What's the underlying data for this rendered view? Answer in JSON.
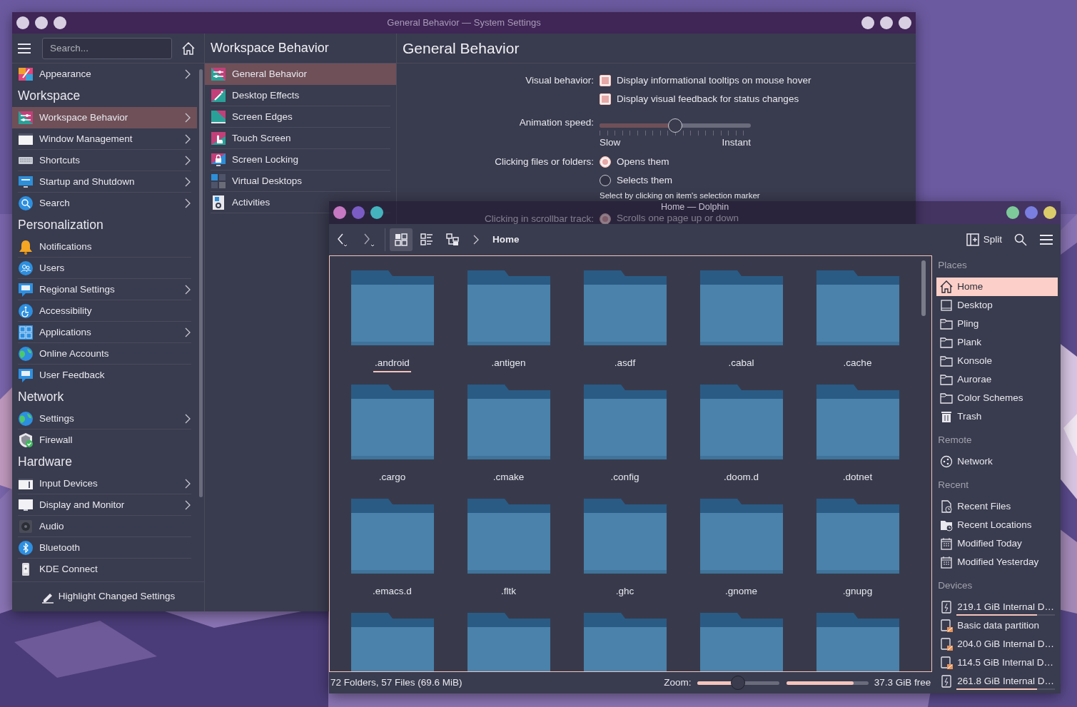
{
  "settings_window": {
    "title": "General Behavior — System Settings",
    "search": {
      "placeholder": "Search..."
    },
    "sidebar": [
      {
        "kind": "item",
        "label": "Appearance",
        "chevron": true,
        "selected": false
      },
      {
        "kind": "heading",
        "label": "Workspace"
      },
      {
        "kind": "item",
        "label": "Workspace Behavior",
        "chevron": true,
        "selected": true
      },
      {
        "kind": "item",
        "label": "Window Management",
        "chevron": true,
        "selected": false
      },
      {
        "kind": "item",
        "label": "Shortcuts",
        "chevron": true,
        "selected": false
      },
      {
        "kind": "item",
        "label": "Startup and Shutdown",
        "chevron": true,
        "selected": false
      },
      {
        "kind": "item",
        "label": "Search",
        "chevron": true,
        "selected": false
      },
      {
        "kind": "heading",
        "label": "Personalization"
      },
      {
        "kind": "item",
        "label": "Notifications",
        "chevron": false,
        "selected": false
      },
      {
        "kind": "item",
        "label": "Users",
        "chevron": false,
        "selected": false
      },
      {
        "kind": "item",
        "label": "Regional Settings",
        "chevron": true,
        "selected": false
      },
      {
        "kind": "item",
        "label": "Accessibility",
        "chevron": false,
        "selected": false
      },
      {
        "kind": "item",
        "label": "Applications",
        "chevron": true,
        "selected": false
      },
      {
        "kind": "item",
        "label": "Online Accounts",
        "chevron": false,
        "selected": false
      },
      {
        "kind": "item",
        "label": "User Feedback",
        "chevron": false,
        "selected": false
      },
      {
        "kind": "heading",
        "label": "Network"
      },
      {
        "kind": "item",
        "label": "Settings",
        "chevron": true,
        "selected": false
      },
      {
        "kind": "item",
        "label": "Firewall",
        "chevron": false,
        "selected": false
      },
      {
        "kind": "heading",
        "label": "Hardware"
      },
      {
        "kind": "item",
        "label": "Input Devices",
        "chevron": true,
        "selected": false
      },
      {
        "kind": "item",
        "label": "Display and Monitor",
        "chevron": true,
        "selected": false
      },
      {
        "kind": "item",
        "label": "Audio",
        "chevron": false,
        "selected": false
      },
      {
        "kind": "item",
        "label": "Bluetooth",
        "chevron": false,
        "selected": false
      },
      {
        "kind": "item",
        "label": "KDE Connect",
        "chevron": false,
        "selected": false
      }
    ],
    "footer_button": "Highlight Changed Settings",
    "subpage": {
      "title": "Workspace Behavior",
      "items": [
        {
          "label": "General Behavior",
          "selected": true
        },
        {
          "label": "Desktop Effects",
          "selected": false
        },
        {
          "label": "Screen Edges",
          "selected": false
        },
        {
          "label": "Touch Screen",
          "selected": false
        },
        {
          "label": "Screen Locking",
          "selected": false
        },
        {
          "label": "Virtual Desktops",
          "selected": false
        },
        {
          "label": "Activities",
          "selected": false
        }
      ]
    },
    "page": {
      "title": "General Behavior",
      "rows": [
        {
          "kind": "checkboxes",
          "label": "Visual behavior:",
          "options": [
            {
              "label": "Display informational tooltips on mouse hover",
              "checked": true
            },
            {
              "label": "Display visual feedback for status changes",
              "checked": true
            }
          ]
        },
        {
          "kind": "slider",
          "label": "Animation speed:",
          "level": 0.5,
          "min_label": "Slow",
          "max_label": "Instant"
        },
        {
          "kind": "radios",
          "label": "Clicking files or folders:",
          "options": [
            {
              "label": "Opens them",
              "selected": true
            },
            {
              "label": "Selects them",
              "selected": false
            }
          ],
          "hint": "Select by clicking on item's selection marker"
        },
        {
          "kind": "radios",
          "label": "Clicking in scrollbar track:",
          "options": [
            {
              "label": "Scrolls one page up or down",
              "selected": true
            }
          ]
        }
      ]
    }
  },
  "dolphin_window": {
    "title": "Home — Dolphin",
    "buttons_left": [
      {
        "color": "#c678c2"
      },
      {
        "color": "#7b5cc4"
      },
      {
        "color": "#45b3bd"
      }
    ],
    "buttons_right": [
      {
        "color": "#7ec99a"
      },
      {
        "color": "#7a7ee0"
      },
      {
        "color": "#dccb6a"
      }
    ],
    "toolbar": {
      "view_modes": [
        {
          "selected": true
        },
        {
          "selected": false
        },
        {
          "selected": false
        }
      ],
      "breadcrumb": "Home",
      "split_button": "Split"
    },
    "files": [
      {
        "name": ".android",
        "selected": true
      },
      {
        "name": ".antigen",
        "selected": false
      },
      {
        "name": ".asdf",
        "selected": false
      },
      {
        "name": ".cabal",
        "selected": false
      },
      {
        "name": ".cache",
        "selected": false
      },
      {
        "name": ".cargo",
        "selected": false
      },
      {
        "name": ".cmake",
        "selected": false
      },
      {
        "name": ".config",
        "selected": false
      },
      {
        "name": ".doom.d",
        "selected": false
      },
      {
        "name": ".dotnet",
        "selected": false
      },
      {
        "name": ".emacs.d",
        "selected": false
      },
      {
        "name": ".fltk",
        "selected": false
      },
      {
        "name": ".ghc",
        "selected": false
      },
      {
        "name": ".gnome",
        "selected": false
      },
      {
        "name": ".gnupg",
        "selected": false
      },
      {
        "selected": false
      },
      {
        "selected": false
      },
      {
        "selected": false
      },
      {
        "selected": false
      },
      {
        "selected": false
      }
    ],
    "places": [
      {
        "heading": "Places",
        "items": [
          {
            "kind": "home",
            "label": "Home",
            "selected": true
          },
          {
            "kind": "desktop",
            "label": "Desktop",
            "selected": false
          },
          {
            "kind": "folder",
            "label": "Pling",
            "selected": false
          },
          {
            "kind": "folder",
            "label": "Plank",
            "selected": false
          },
          {
            "kind": "folder",
            "label": "Konsole",
            "selected": false
          },
          {
            "kind": "folder",
            "label": "Aurorae",
            "selected": false
          },
          {
            "kind": "folder",
            "label": "Color Schemes",
            "selected": false
          },
          {
            "kind": "trash",
            "label": "Trash",
            "selected": false
          }
        ]
      },
      {
        "heading": "Remote",
        "items": [
          {
            "kind": "network",
            "label": "Network",
            "selected": false
          }
        ]
      },
      {
        "heading": "Recent",
        "items": [
          {
            "kind": "recent-file",
            "label": "Recent Files",
            "selected": false
          },
          {
            "kind": "recent-folder",
            "label": "Recent Locations",
            "selected": false
          },
          {
            "kind": "calendar",
            "label": "Modified Today",
            "selected": false
          },
          {
            "kind": "calendar",
            "label": "Modified Yesterday",
            "selected": false
          }
        ]
      },
      {
        "heading": "Devices",
        "items": [
          {
            "kind": "drive",
            "label": "219.1 GiB Internal D…",
            "selected": false,
            "level": 0.82
          },
          {
            "kind": "partition",
            "label": "Basic data partition",
            "selected": false
          },
          {
            "kind": "partition",
            "label": "204.0 GiB Internal D…",
            "selected": false
          },
          {
            "kind": "partition",
            "label": "114.5 GiB Internal D…",
            "selected": false
          },
          {
            "kind": "drive",
            "label": "261.8 GiB Internal D…",
            "selected": false,
            "level": 0.82
          }
        ]
      }
    ],
    "status": {
      "summary": "72 Folders, 57 Files (69.6 MiB)",
      "zoom_label": "Zoom:",
      "zoom": {
        "level": 0.5
      },
      "space": {
        "level": 0.82
      },
      "free_label": "37.3 GiB free"
    }
  }
}
